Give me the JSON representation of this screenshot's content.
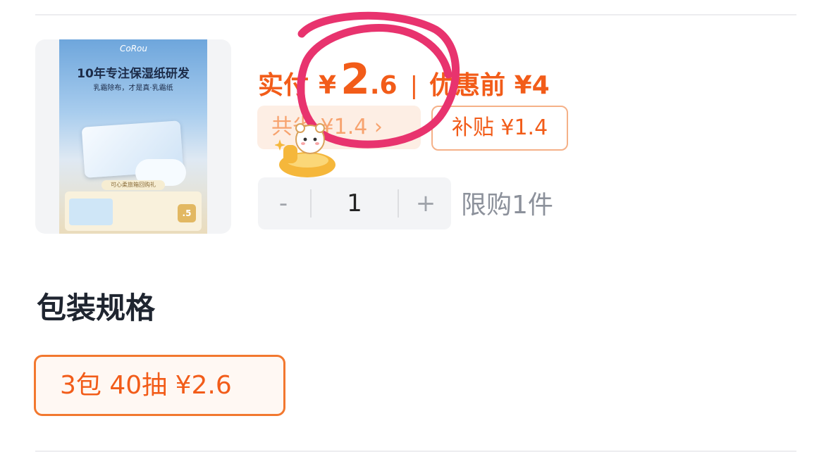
{
  "product": {
    "image_brand": "CoRou",
    "image_headline": "10年专注保湿纸研发",
    "image_subline": "乳霜除布，才是真·乳霜纸",
    "image_gift_text": "可心柔旅箱回购礼",
    "image_coin_text": ".5"
  },
  "price": {
    "actual_label": "实付",
    "currency": "¥",
    "actual_int": "2",
    "actual_dec": ".6",
    "separator": "|",
    "before_label": "优惠前 ¥4"
  },
  "tags": {
    "discount": "共省 ¥1.4 ›",
    "subsidy": "补贴 ¥1.4"
  },
  "quantity": {
    "minus": "-",
    "value": "1",
    "plus": "+",
    "limit": "限购1件"
  },
  "spec": {
    "title": "包装规格",
    "option": "3包  40抽  ¥2.6"
  },
  "colors": {
    "accent": "#f25c19",
    "annotation": "#e8336e"
  }
}
